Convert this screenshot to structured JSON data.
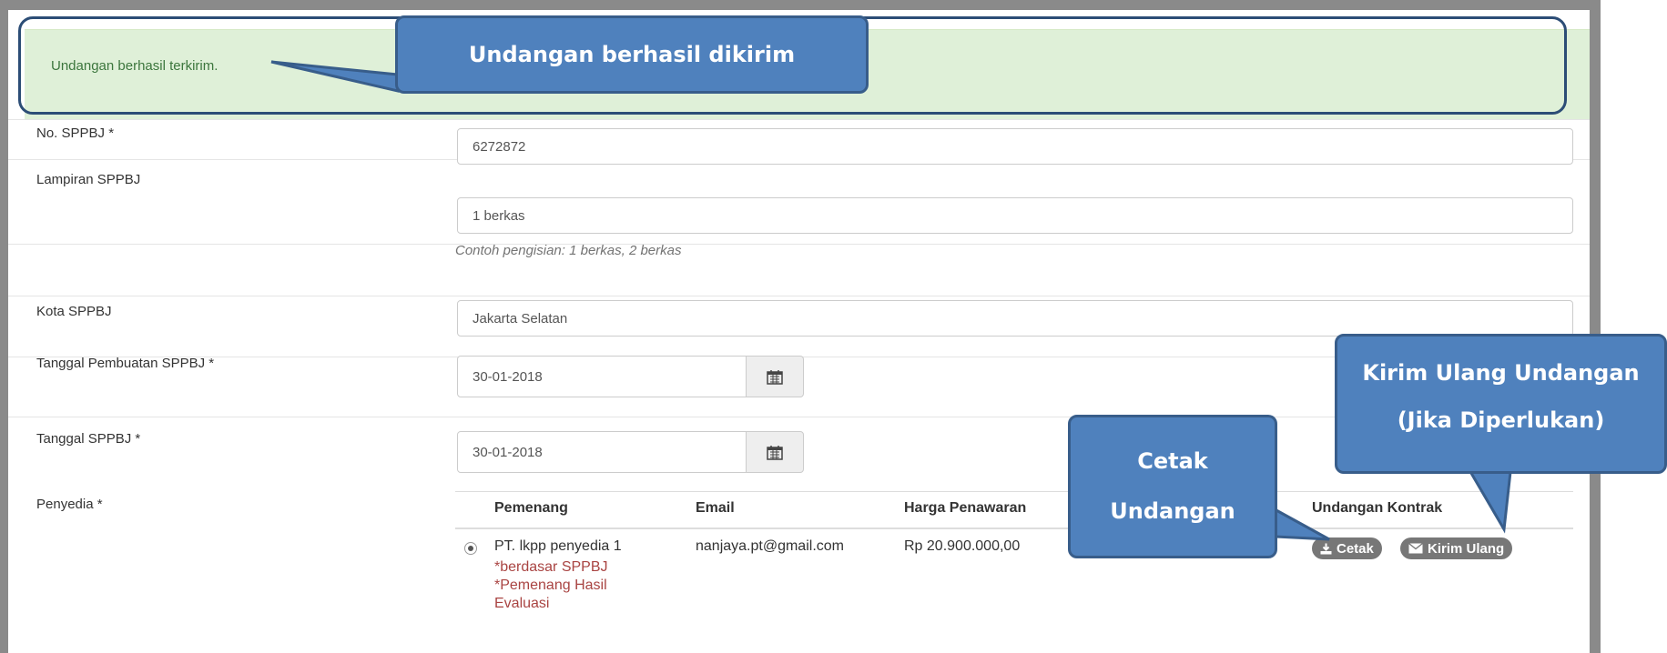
{
  "alert": {
    "message": "Undangan berhasil terkirim."
  },
  "form": {
    "no_sppbj": {
      "label": "No. SPPBJ *",
      "value": "6272872"
    },
    "lampiran": {
      "label": "Lampiran SPPBJ",
      "value": "1 berkas",
      "help": "Contoh pengisian: 1 berkas, 2 berkas"
    },
    "kota": {
      "label": "Kota SPPBJ",
      "value": "Jakarta Selatan"
    },
    "tanggal_pembuatan": {
      "label": "Tanggal Pembuatan SPPBJ *",
      "value": "30-01-2018"
    },
    "tanggal": {
      "label": "Tanggal SPPBJ *",
      "value": "30-01-2018"
    },
    "penyedia": {
      "label": "Penyedia *"
    }
  },
  "table": {
    "headers": [
      "Pemenang",
      "Email",
      "Harga Penawaran",
      "Undangan Kontrak"
    ],
    "rows": [
      {
        "pemenang": "PT. lkpp penyedia 1",
        "notes": [
          "*berdasar SPPBJ",
          "*Pemenang Hasil",
          "Evaluasi"
        ],
        "email": "nanjaya.pt@gmail.com",
        "harga": "Rp 20.900.000,00",
        "cetak_label": "Cetak",
        "kirim_ulang_label": "Kirim Ulang"
      }
    ]
  },
  "callouts": {
    "top": "Undangan berhasil dikirim",
    "cetak": [
      "Cetak",
      "Undangan"
    ],
    "kirim": [
      "Kirim Ulang Undangan",
      "(Jika Diperlukan)"
    ]
  },
  "colors": {
    "alert_bg": "#dff0d8",
    "alert_text": "#3c763d",
    "callout_fill": "#4f81bd",
    "callout_border": "#385d8a",
    "note_red": "#a94442",
    "button_gray": "#777777"
  }
}
